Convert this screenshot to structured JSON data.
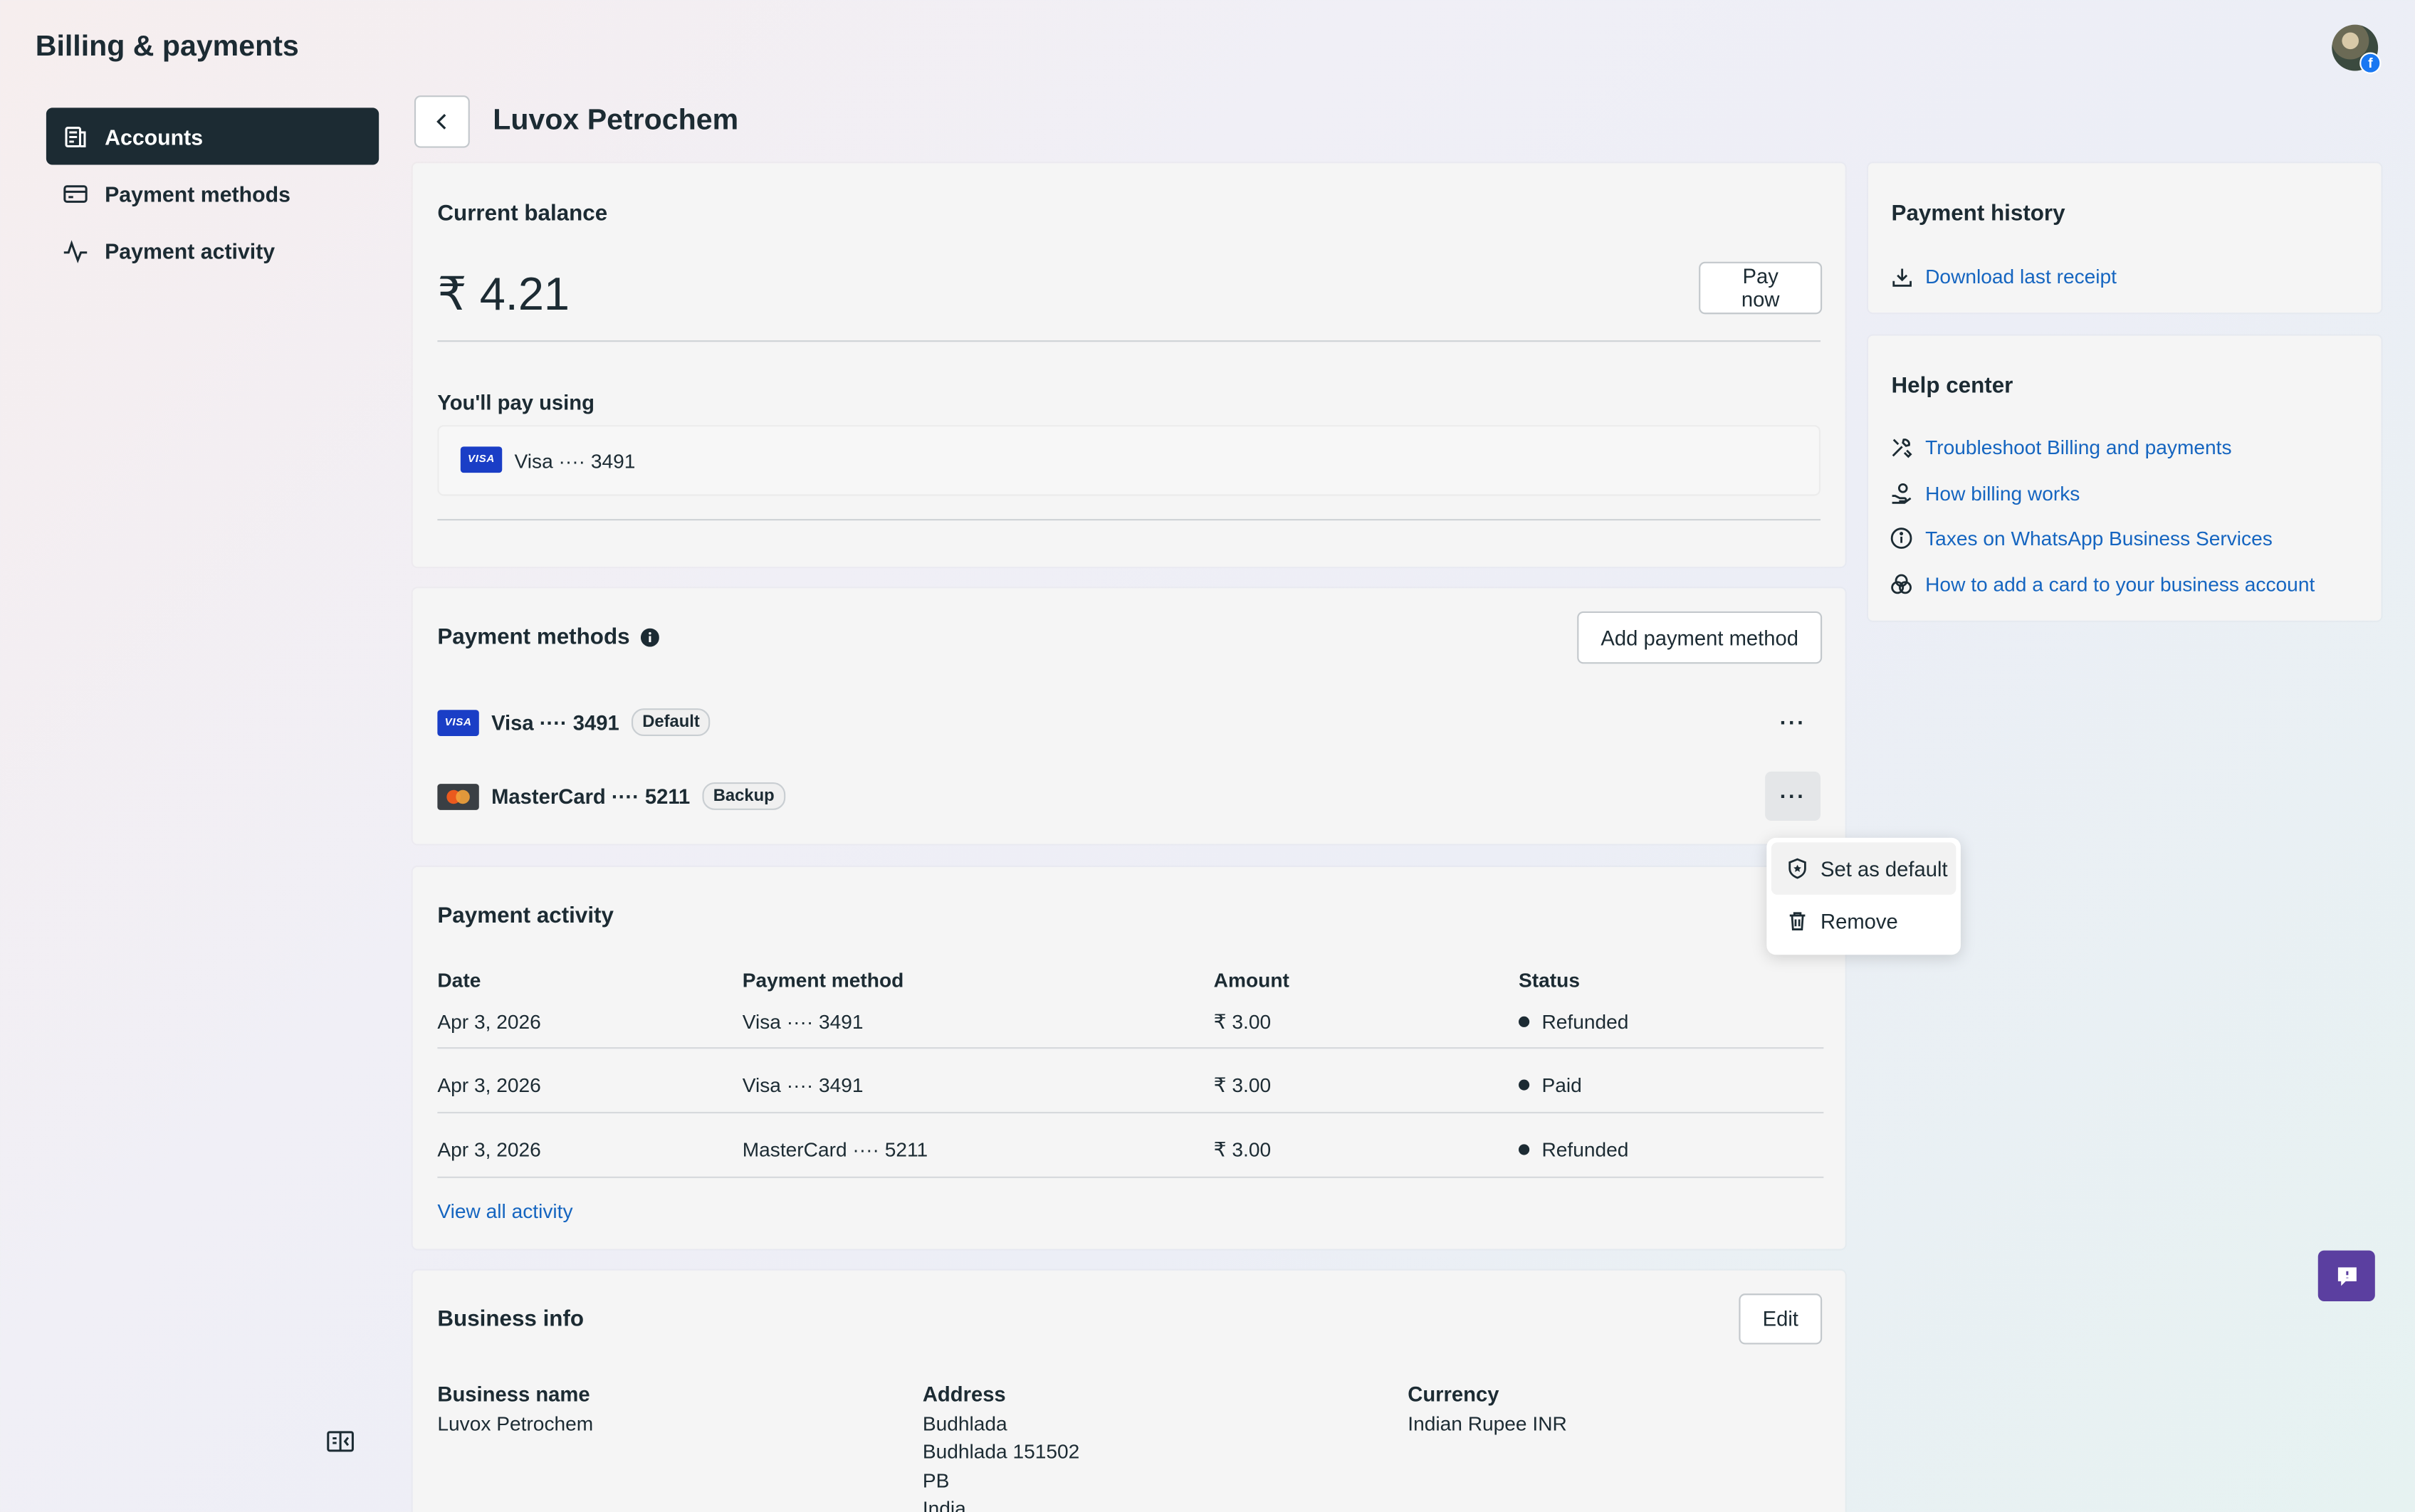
{
  "app": {
    "title": "Billing & payments"
  },
  "sidebar": {
    "items": [
      {
        "label": "Accounts",
        "icon": "accounts-icon",
        "active": true
      },
      {
        "label": "Payment methods",
        "icon": "card-icon",
        "active": false
      },
      {
        "label": "Payment activity",
        "icon": "activity-icon",
        "active": false
      }
    ]
  },
  "header": {
    "title": "Luvox Petrochem"
  },
  "balance": {
    "title": "Current balance",
    "amount": "₹ 4.21",
    "pay_now": "Pay now",
    "pay_using_label": "You'll pay using",
    "pay_using_method": "Visa ···· 3491",
    "visa_logo_text": "VISA"
  },
  "payment_methods": {
    "title": "Payment methods",
    "add_button": "Add payment method",
    "items": [
      {
        "name": "Visa ···· 3491",
        "badge": "Default",
        "logo": "visa",
        "logo_text": "VISA"
      },
      {
        "name": "MasterCard ···· 5211",
        "badge": "Backup",
        "logo": "mastercard"
      }
    ],
    "more_label": "···"
  },
  "menu": {
    "items": [
      {
        "label": "Set as default",
        "icon": "shield-star-icon"
      },
      {
        "label": "Remove",
        "icon": "trash-icon"
      }
    ]
  },
  "activity": {
    "title": "Payment activity",
    "columns": [
      "Date",
      "Payment method",
      "Amount",
      "Status"
    ],
    "rows": [
      {
        "date": "Apr 3, 2026",
        "method": "Visa ···· 3491",
        "amount": "₹ 3.00",
        "status": "Refunded"
      },
      {
        "date": "Apr 3, 2026",
        "method": "Visa ···· 3491",
        "amount": "₹ 3.00",
        "status": "Paid"
      },
      {
        "date": "Apr 3, 2026",
        "method": "MasterCard ···· 5211",
        "amount": "₹ 3.00",
        "status": "Refunded"
      }
    ],
    "view_all": "View all activity"
  },
  "business": {
    "title": "Business info",
    "edit": "Edit",
    "name_label": "Business name",
    "name_value": "Luvox Petrochem",
    "address_label": "Address",
    "address_lines": [
      "Budhlada",
      "Budhlada 151502",
      "PB",
      "India"
    ],
    "currency_label": "Currency",
    "currency_value": "Indian Rupee INR"
  },
  "history": {
    "title": "Payment history",
    "download": "Download last receipt"
  },
  "help": {
    "title": "Help center",
    "links": [
      {
        "label": "Troubleshoot Billing and payments",
        "icon": "tools-icon"
      },
      {
        "label": "How billing works",
        "icon": "hand-coin-icon"
      },
      {
        "label": "Taxes on WhatsApp Business Services",
        "icon": "info-icon"
      },
      {
        "label": "How to add a card to your business account",
        "icon": "circles-icon"
      }
    ]
  },
  "avatar": {
    "badge": "f"
  },
  "colors": {
    "primary_dark": "#1c2b33",
    "link": "#1565c0",
    "chat": "#5b3fa0",
    "visa": "#1a3ec6"
  }
}
